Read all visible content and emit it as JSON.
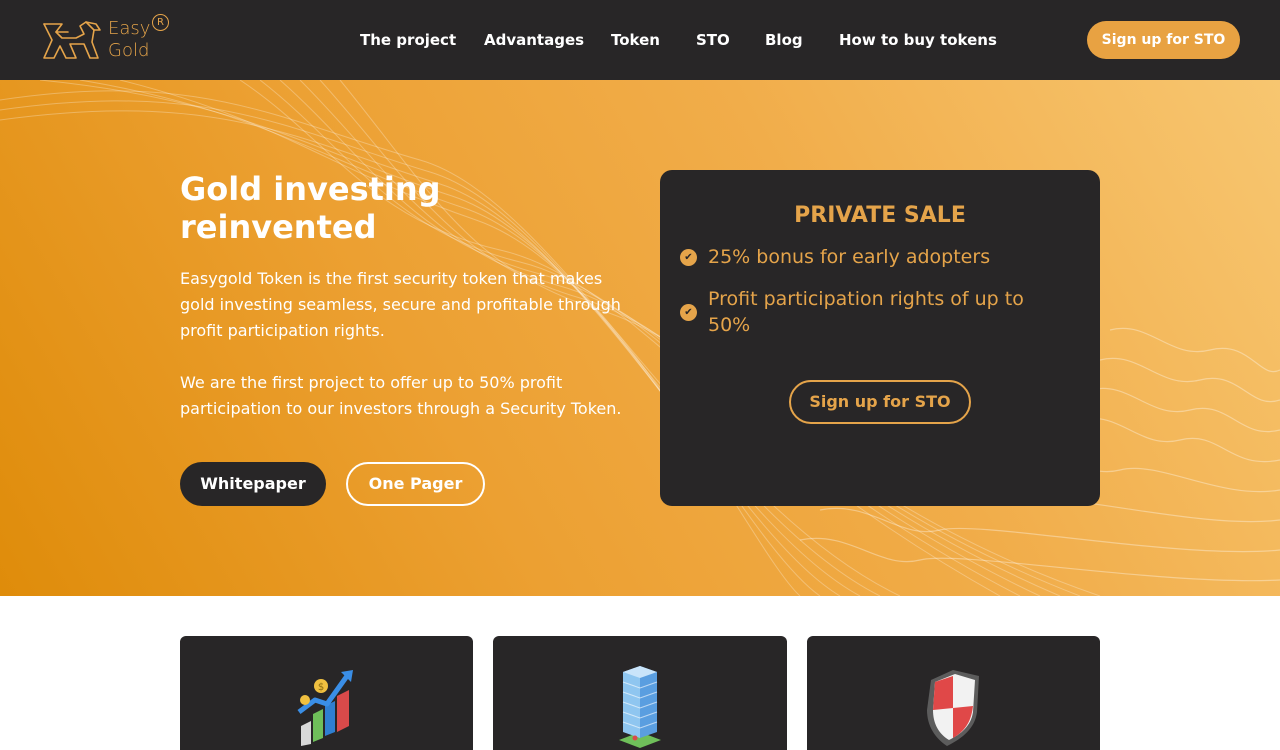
{
  "header": {
    "logo": {
      "line1": "Easy",
      "line2": "Gold",
      "reg": "R"
    },
    "nav": [
      {
        "label": "The project"
      },
      {
        "label": "Advantages"
      },
      {
        "label": "Token"
      },
      {
        "label": "STO"
      },
      {
        "label": "Blog"
      },
      {
        "label": "How to buy tokens"
      }
    ],
    "cta_label": "Sign up for STO"
  },
  "hero": {
    "title": "Gold investing reinvented",
    "paragraph1": "Easygold Token is the first security token that makes gold investing seamless, secure and profitable through profit participation rights.",
    "paragraph2": "We are the first project to offer up to 50% profit participation to our investors through a Security Token.",
    "whitepaper_label": "Whitepaper",
    "onepager_label": "One Pager"
  },
  "sale": {
    "title": "PRIVATE SALE",
    "items": [
      {
        "text": "25% bonus for early adopters",
        "icon": "check-circle-icon"
      },
      {
        "text": "Profit participation rights of up to 50%",
        "icon": "check-circle-icon"
      }
    ],
    "cta_label": "Sign up for STO"
  },
  "features": [
    {
      "icon": "growth-chart-icon"
    },
    {
      "icon": "skyscraper-icon"
    },
    {
      "icon": "shield-icon"
    }
  ],
  "colors": {
    "dark": "#282627",
    "gold": "#e5a44a",
    "hero_orange": "#eca032"
  }
}
